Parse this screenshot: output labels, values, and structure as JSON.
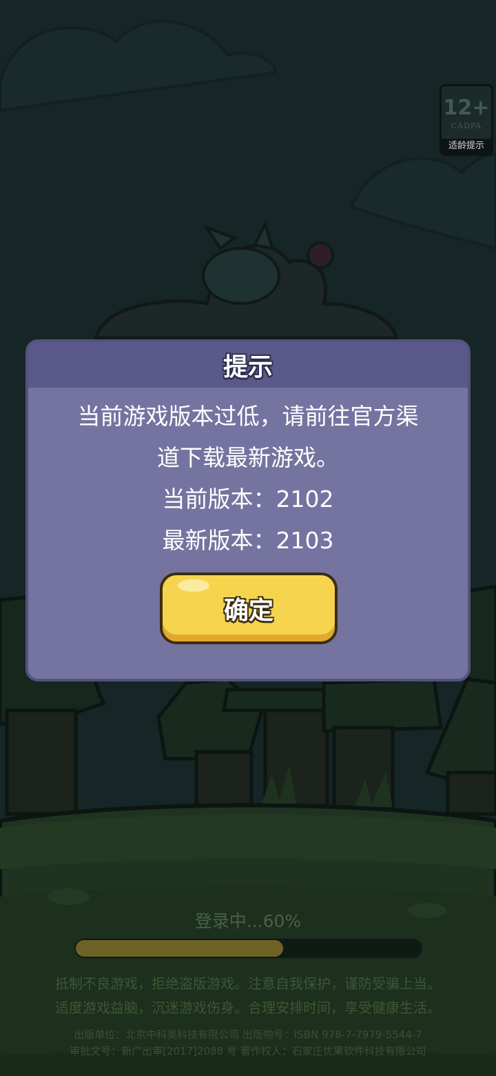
{
  "age_rating": {
    "rating": "12+",
    "org": "CADPA",
    "label": "适龄提示"
  },
  "dialog": {
    "title": "提示",
    "message_line1": "当前游戏版本过低，请前往官方渠",
    "message_line2": "道下载最新游戏。",
    "current_version": "当前版本：2102",
    "latest_version": "最新版本：2103",
    "confirm_label": "确定"
  },
  "loading": {
    "text": "登录中...60%",
    "progress": 0.6
  },
  "health_notice": {
    "line1": "抵制不良游戏，拒绝盗版游戏。注意自我保护，谨防受骗上当。",
    "line2": "适度游戏益脑，沉迷游戏伤身。合理安排时间，享受健康生活。"
  },
  "publisher": {
    "line1": "出版单位：北京中科奥科技有限公司 出版物号：ISBN 978-7-7979-5544-7",
    "line2": "审批文号：新广出审[2017]2088 号 著作权人：石家庄优果软件科技有限公司"
  },
  "colors": {
    "dialog_bg": "#7574a0",
    "title_bar": "#5b588a",
    "button": "#f6d44d"
  }
}
